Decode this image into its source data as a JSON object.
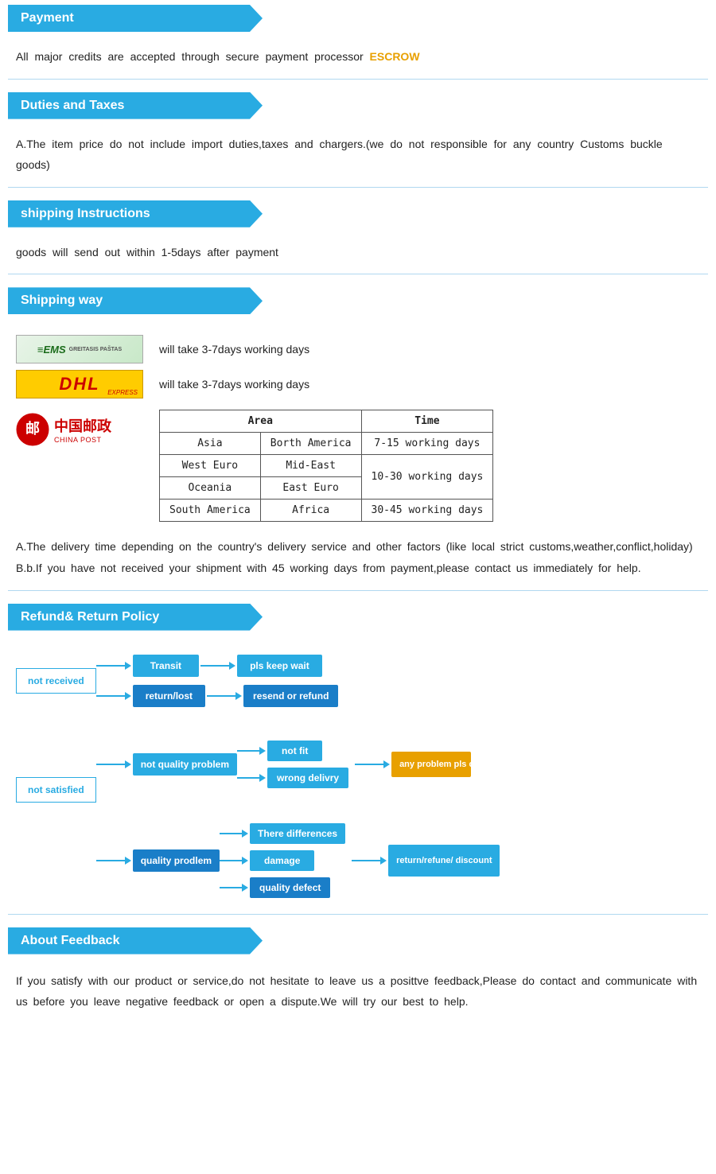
{
  "payment": {
    "header": "Payment",
    "content": "All  major  credits  are  accepted  through  secure  payment  processor",
    "escrow": "ESCROW"
  },
  "duties": {
    "header": "Duties  and  Taxes",
    "content": "A.The  item  price  do  not  include  import  duties,taxes  and  chargers.(we  do  not  responsible  for  any  country  Customs  buckle  goods)"
  },
  "shipping_instructions": {
    "header": "shipping  Instructions",
    "content": "goods  will  send  out  within  1-5days  after  payment"
  },
  "shipping_way": {
    "header": "Shipping  way",
    "ems_desc": "will  take  3-7days  working  days",
    "dhl_desc": "will  take  3-7days  working  days",
    "table": {
      "headers": [
        "Area",
        "Time"
      ],
      "rows": [
        [
          "Asia",
          "Borth America",
          "7-15 working days"
        ],
        [
          "West Euro",
          "Mid-East",
          "10-30 working days"
        ],
        [
          "Oceania",
          "East Euro",
          ""
        ],
        [
          "South America",
          "Africa",
          "30-45 working days"
        ]
      ]
    },
    "note_a": "A.The  delivery  time  depending  on  the  country's  delivery  service  and  other  factors  (like  local  strict   customs,weather,conflict,holiday)",
    "note_b": "B.b.If  you  have  not  received  your  shipment  with  45  working  days  from  payment,please  contact  us   immediately  for  help."
  },
  "refund": {
    "header": "Refund&  Return  Policy",
    "not_received": "not  received",
    "transit": "Transit",
    "return_lost": "return/lost",
    "pls_keep_wait": "pls  keep  wait",
    "resend_or_refund": "resend  or  refund",
    "not_satisfied": "not  satisfied",
    "not_quality_problem": "not  quality  problem",
    "not_fit": "not  fit",
    "wrong_delivery": "wrong  delivry",
    "quality_problem": "quality  prodlem",
    "there_differences": "There  differences",
    "damage": "damage",
    "quality_defect": "quality  defect",
    "any_problem": "any  problem  pls  contact  me",
    "return_refund": "return/refune/ discount"
  },
  "feedback": {
    "header": "About  Feedback",
    "content": "If  you  satisfy  with  our  product  or  service,do  not  hesitate  to  leave  us  a  posittve  feedback,Please  do  contact  and  communicate  with  us  before  you  leave  negative  feedback  or  open  a  dispute.We  will  try  our  best  to  help."
  }
}
